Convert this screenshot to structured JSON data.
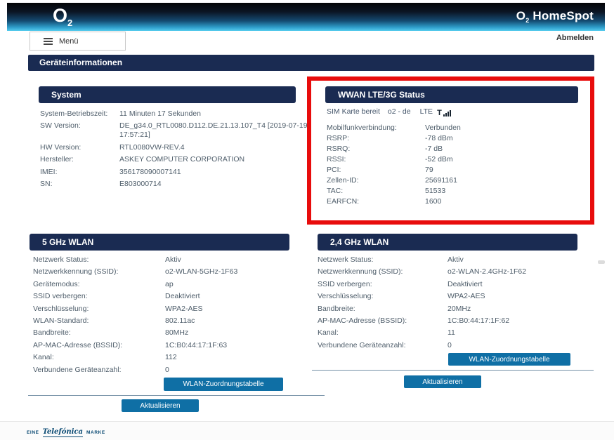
{
  "colors": {
    "navy": "#1a2b52",
    "btn": "#0f6fa5",
    "red": "#e80c0c",
    "header_gradient_top": "#040507",
    "header_gradient_bottom": "#55cbee"
  },
  "header": {
    "logo_o": "O",
    "logo_sub": "2",
    "brand_o": "O",
    "brand_sub": "2",
    "brand_name": "HomeSpot",
    "menu_label": "Menü",
    "logout_label": "Abmelden",
    "icons": {
      "menu": "hamburger-icon"
    }
  },
  "page_title": "Geräteinformationen",
  "system": {
    "title": "System",
    "rows": [
      {
        "label": "System-Betriebszeit:",
        "value": "11 Minuten 17 Sekunden"
      },
      {
        "label": "SW Version:",
        "value": "DE_g34.0_RTL0080.D112.DE.21.13.107_T4 [2019-07-19 17:57:21]"
      },
      {
        "label": "HW Version:",
        "value": "RTL0080VW-REV.4"
      },
      {
        "label": "Hersteller:",
        "value": "ASKEY COMPUTER CORPORATION"
      },
      {
        "label": "IMEI:",
        "value": "356178090007141"
      },
      {
        "label": "SN:",
        "value": "E803000714"
      }
    ]
  },
  "wwan": {
    "title": "WWAN LTE/3G Status",
    "sim_status": "SIM Karte bereit",
    "operator": "o2 - de",
    "network": "LTE",
    "signal_label": "T",
    "signal_icon": "signal-bars-icon",
    "rows": [
      {
        "label": "Mobilfunkverbindung:",
        "value": "Verbunden"
      },
      {
        "label": "RSRP:",
        "value": "-78 dBm"
      },
      {
        "label": "RSRQ:",
        "value": "-7 dB"
      },
      {
        "label": "RSSI:",
        "value": "-52 dBm"
      },
      {
        "label": "PCI:",
        "value": "79"
      },
      {
        "label": "Zellen-ID:",
        "value": "25691161"
      },
      {
        "label": "TAC:",
        "value": "51533"
      },
      {
        "label": "EARFCN:",
        "value": "1600"
      }
    ]
  },
  "wlan5": {
    "title": "5 GHz WLAN",
    "rows": [
      {
        "label": "Netzwerk Status:",
        "value": "Aktiv"
      },
      {
        "label": "Netzwerkkennung (SSID):",
        "value": "o2-WLAN-5GHz-1F63"
      },
      {
        "label": "Gerätemodus:",
        "value": "ap"
      },
      {
        "label": "SSID verbergen:",
        "value": "Deaktiviert"
      },
      {
        "label": "Verschlüsselung:",
        "value": "WPA2-AES"
      },
      {
        "label": "WLAN-Standard:",
        "value": "802.11ac"
      },
      {
        "label": "Bandbreite:",
        "value": "80MHz"
      },
      {
        "label": "AP-MAC-Adresse (BSSID):",
        "value": "1C:B0:44:17:1F:63"
      },
      {
        "label": "Kanal:",
        "value": "112"
      },
      {
        "label": "Verbundene Geräteanzahl:",
        "value": "0"
      }
    ],
    "table_button": "WLAN-Zuordnungstabelle",
    "refresh_button": "Aktualisieren"
  },
  "wlan24": {
    "title": "2,4 GHz WLAN",
    "rows": [
      {
        "label": "Netzwerk Status:",
        "value": "Aktiv"
      },
      {
        "label": "Netzwerkkennung (SSID):",
        "value": "o2-WLAN-2.4GHz-1F62"
      },
      {
        "label": "SSID verbergen:",
        "value": "Deaktiviert"
      },
      {
        "label": "Verschlüsselung:",
        "value": "WPA2-AES"
      },
      {
        "label": "Bandbreite:",
        "value": "20MHz"
      },
      {
        "label": "AP-MAC-Adresse (BSSID):",
        "value": "1C:B0:44:17:1F:62"
      },
      {
        "label": "Kanal:",
        "value": "11"
      },
      {
        "label": "Verbundene Geräteanzahl:",
        "value": "0"
      }
    ],
    "table_button": "WLAN-Zuordnungstabelle",
    "refresh_button": "Aktualisieren"
  },
  "footer": {
    "pre": "EINE",
    "brand": "Telefónica",
    "post": "MARKE"
  }
}
